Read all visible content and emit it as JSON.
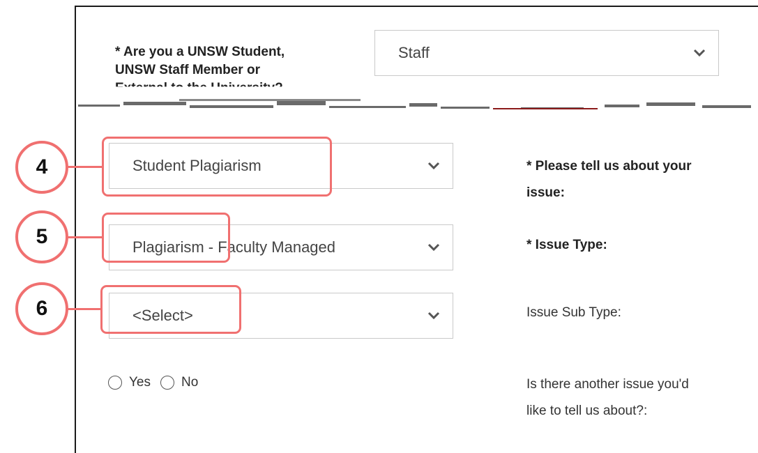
{
  "q1": {
    "label_lines": [
      "* Are you a UNSW Student,",
      "UNSW Staff Member or",
      "External to the University?"
    ],
    "value": "Staff"
  },
  "issue": {
    "label_lines": [
      "* Please tell us about your",
      "issue:"
    ],
    "value": "Student Plagiarism"
  },
  "issue_type": {
    "label": "* Issue Type:",
    "value": "Plagiarism - Faculty Managed"
  },
  "issue_sub_type": {
    "label": "Issue Sub Type:",
    "value": "<Select>"
  },
  "another_issue": {
    "label_lines": [
      "Is there another issue you'd",
      "like to tell us about?:"
    ],
    "options": [
      "Yes",
      "No"
    ]
  },
  "callouts": [
    "4",
    "5",
    "6"
  ],
  "colors": {
    "callout": "#f07070",
    "border": "#c9c9c9",
    "frame": "#1a1a1a"
  },
  "icons": {
    "dropdown": "chevron-down-icon",
    "radio": "radio-button"
  }
}
